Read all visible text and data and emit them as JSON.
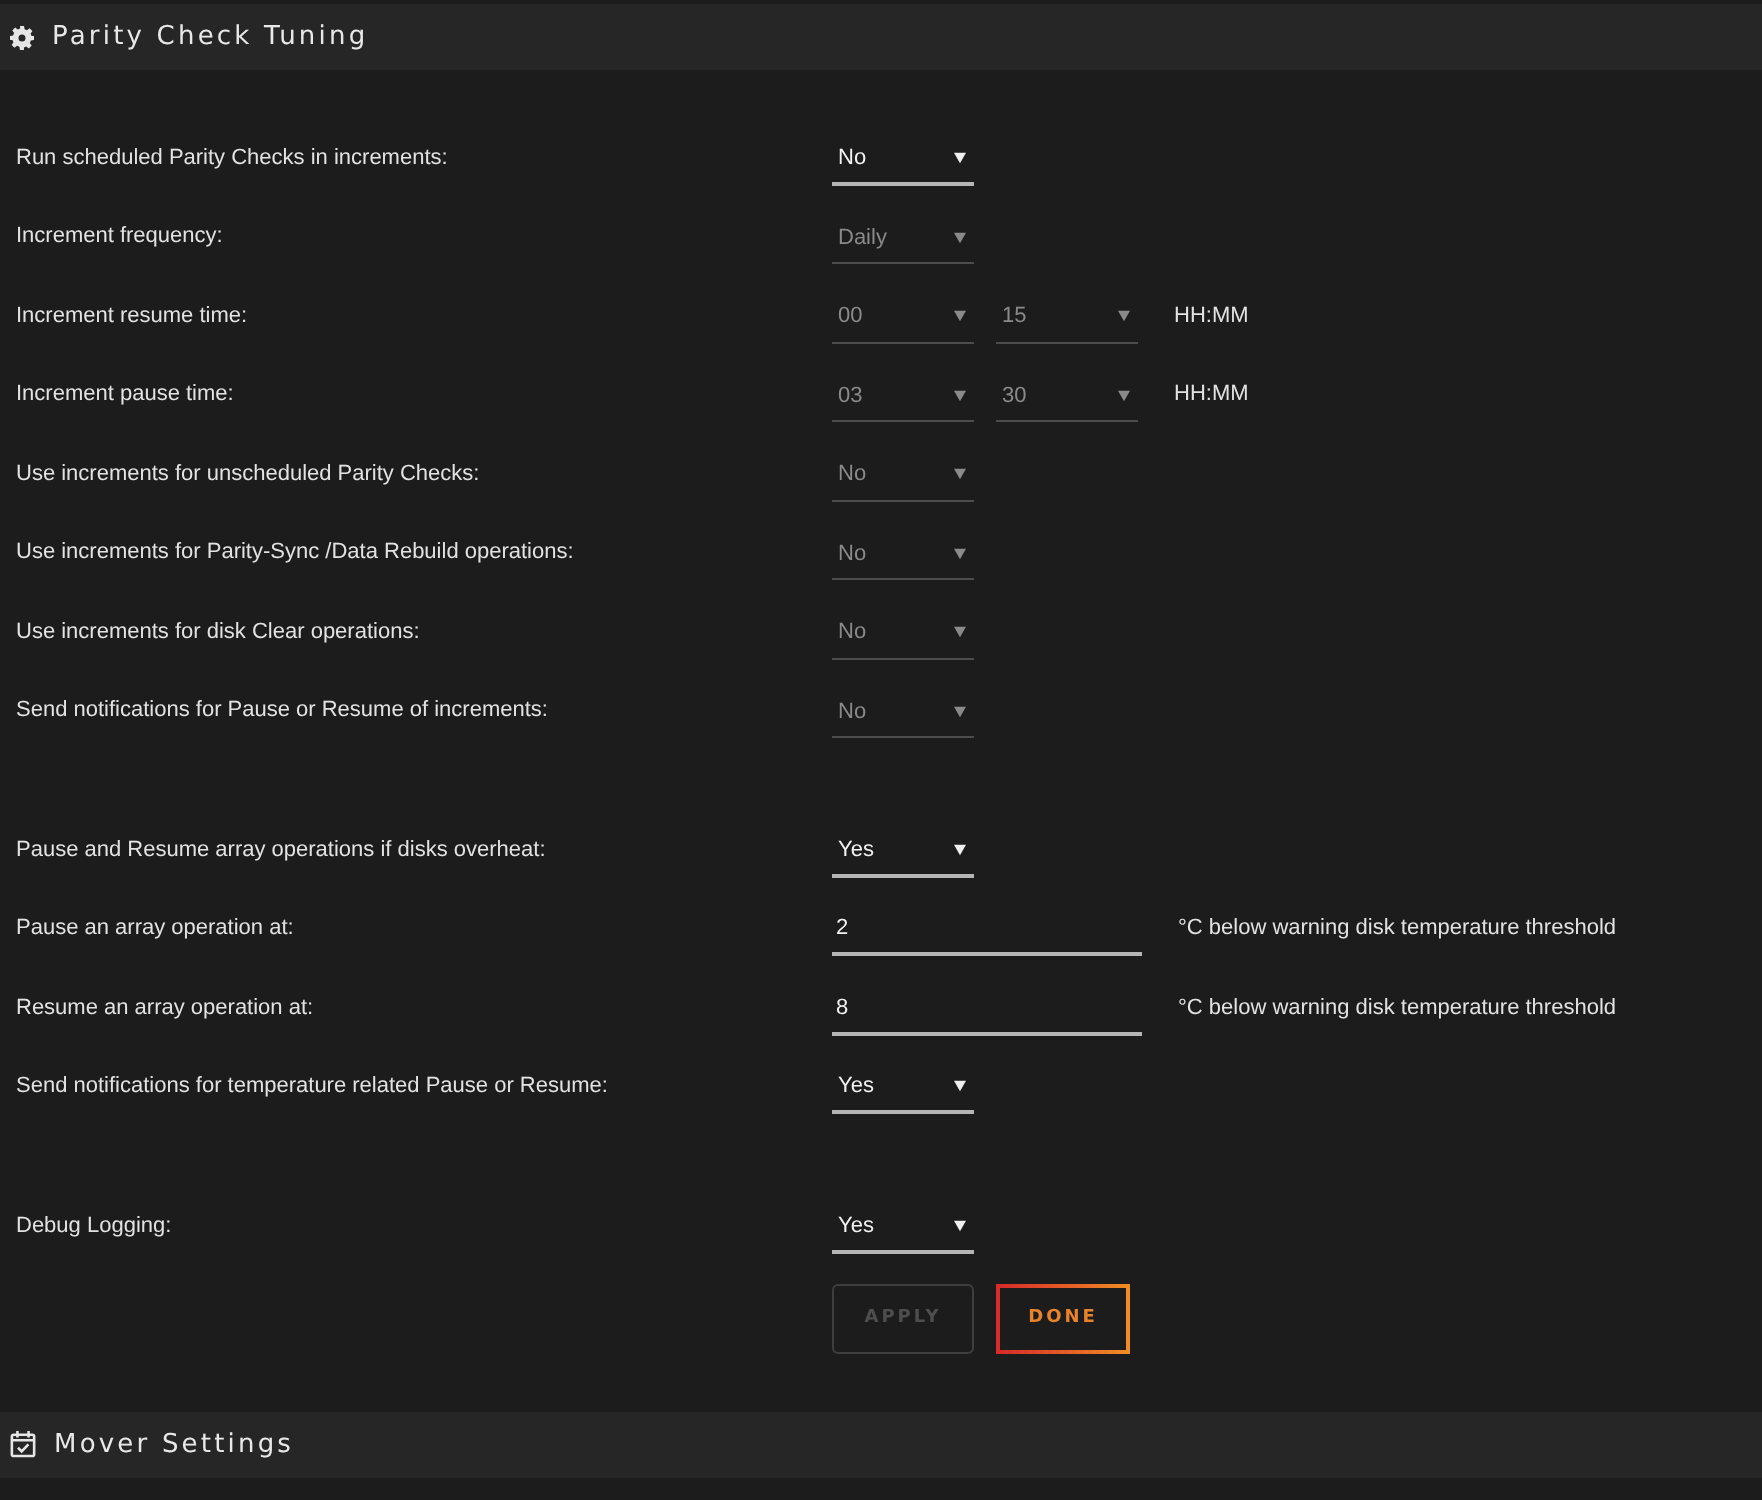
{
  "header": {
    "title": "Parity Check Tuning"
  },
  "groups": [
    {
      "rows": [
        {
          "label": "Run scheduled Parity Checks in increments:",
          "controls": [
            {
              "kind": "select",
              "value": "No",
              "disabled": false
            }
          ]
        },
        {
          "label": "Increment frequency:",
          "controls": [
            {
              "kind": "select",
              "value": "Daily",
              "disabled": true
            }
          ]
        },
        {
          "label": "Increment resume time:",
          "controls": [
            {
              "kind": "select",
              "value": "00",
              "disabled": true
            },
            {
              "kind": "select",
              "value": "15",
              "disabled": true
            }
          ],
          "suffix": "HH:MM"
        },
        {
          "label": "Increment pause time:",
          "controls": [
            {
              "kind": "select",
              "value": "03",
              "disabled": true
            },
            {
              "kind": "select",
              "value": "30",
              "disabled": true
            }
          ],
          "suffix": "HH:MM"
        },
        {
          "label": "Use increments for unscheduled Parity Checks:",
          "controls": [
            {
              "kind": "select",
              "value": "No",
              "disabled": true
            }
          ]
        },
        {
          "label": "Use increments for Parity-Sync /Data Rebuild operations:",
          "controls": [
            {
              "kind": "select",
              "value": "No",
              "disabled": true
            }
          ]
        },
        {
          "label": "Use increments for disk Clear operations:",
          "controls": [
            {
              "kind": "select",
              "value": "No",
              "disabled": true
            }
          ]
        },
        {
          "label": "Send notifications for Pause or Resume of increments:",
          "controls": [
            {
              "kind": "select",
              "value": "No",
              "disabled": true
            }
          ]
        }
      ]
    },
    {
      "rows": [
        {
          "label": "Pause and Resume array operations if disks overheat:",
          "controls": [
            {
              "kind": "select",
              "value": "Yes",
              "disabled": false
            }
          ]
        },
        {
          "label": "Pause an array operation at:",
          "controls": [
            {
              "kind": "input",
              "value": "2",
              "disabled": false
            }
          ],
          "suffix": "°C below warning disk temperature threshold"
        },
        {
          "label": "Resume an array operation at:",
          "controls": [
            {
              "kind": "input",
              "value": "8",
              "disabled": false
            }
          ],
          "suffix": "°C below warning disk temperature threshold"
        },
        {
          "label": "Send notifications for temperature related Pause or Resume:",
          "controls": [
            {
              "kind": "select",
              "value": "Yes",
              "disabled": false
            }
          ]
        }
      ]
    },
    {
      "rows": [
        {
          "label": "Debug Logging:",
          "controls": [
            {
              "kind": "select",
              "value": "Yes",
              "disabled": false
            }
          ]
        }
      ]
    }
  ],
  "buttons": [
    {
      "label": "APPLY",
      "disabled": true
    },
    {
      "label": "DONE",
      "disabled": false
    }
  ],
  "next_section": {
    "title": "Mover Settings"
  }
}
